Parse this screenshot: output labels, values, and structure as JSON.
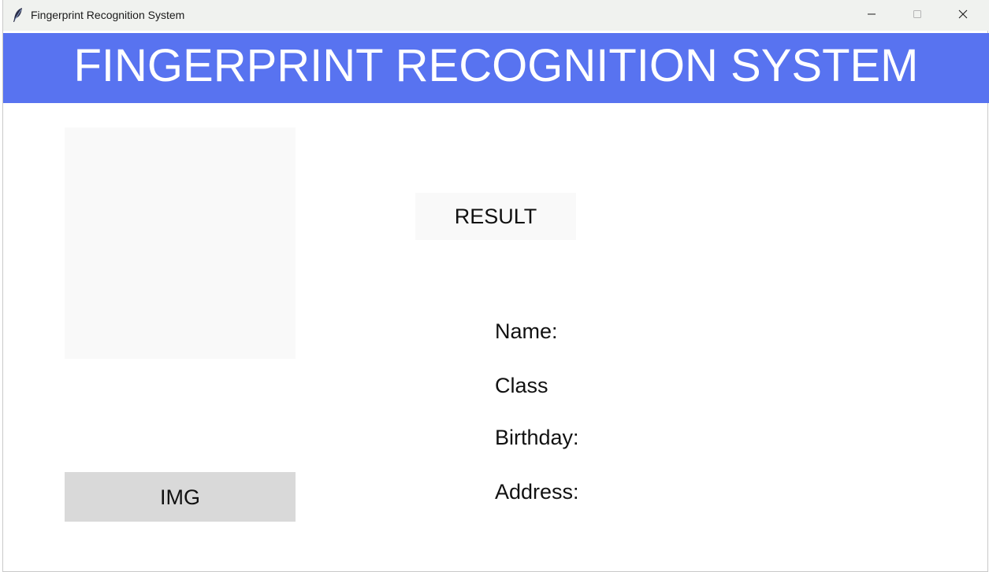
{
  "window": {
    "title": "Fingerprint Recognition System",
    "icon": "feather-icon",
    "controls": [
      "minimize-icon",
      "maximize-icon",
      "close-icon"
    ]
  },
  "header": {
    "title": "FINGERPRINT RECOGNITION SYSTEM",
    "background": "#5873f0"
  },
  "left_panel": {
    "image_button_label": "IMG"
  },
  "result": {
    "button_label": "RESULT"
  },
  "info": {
    "name_label": "Name:",
    "class_label": "Class",
    "birthday_label": "Birthday:",
    "address_label": "Address:"
  }
}
